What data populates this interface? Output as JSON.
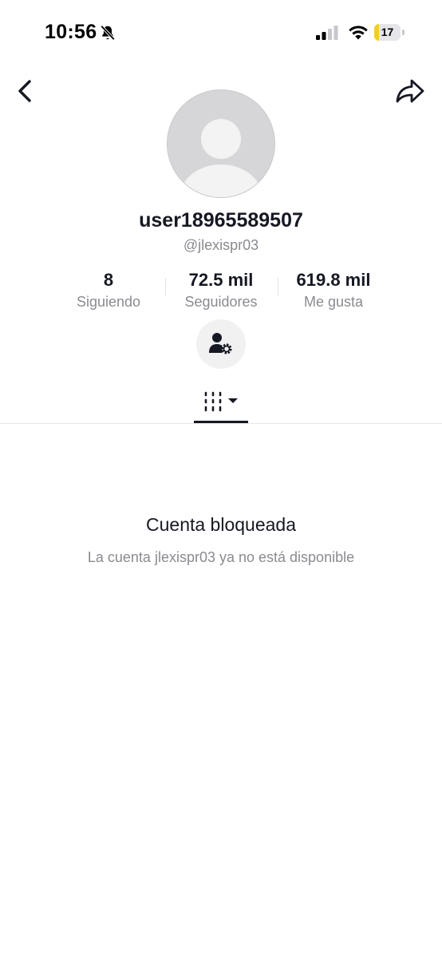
{
  "status_bar": {
    "time": "10:56",
    "battery_level": "17",
    "battery_percent": 17,
    "icons": [
      "bell-slash-icon",
      "cellular-signal-icon",
      "wifi-icon",
      "battery-icon"
    ],
    "battery_color": "#f5cd1f"
  },
  "header": {
    "icons": [
      "chevron-left-icon",
      "share-arrow-icon"
    ]
  },
  "profile": {
    "username": "user18965589507",
    "handle": "@jlexispr03",
    "avatar": "default-avatar-icon"
  },
  "stats": [
    {
      "value": "8",
      "label": "Siguiendo"
    },
    {
      "value": "72.5 mil",
      "label": "Seguidores"
    },
    {
      "value": "619.8 mil",
      "label": "Me gusta"
    }
  ],
  "actions": {
    "settings_icon": "user-settings-icon"
  },
  "tabs": {
    "active_icon": "grid-lines-icon",
    "dropdown_icon": "caret-down-icon"
  },
  "blocked": {
    "title": "Cuenta bloqueada",
    "message": "La cuenta jlexispr03 ya no está disponible"
  },
  "colors": {
    "text_primary": "#161823",
    "text_secondary": "#8a8b91",
    "background": "#ffffff"
  }
}
